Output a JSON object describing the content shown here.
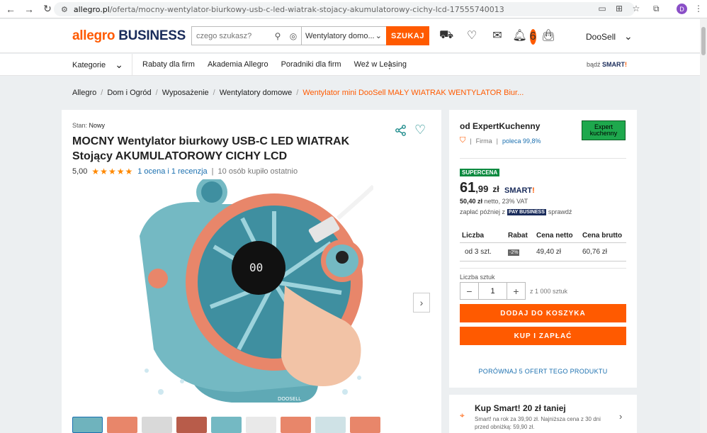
{
  "browser": {
    "url_domain": "allegro.pl",
    "url_path": "/oferta/mocny-wentylator-biurkowy-usb-c-led-wiatrak-stojacy-akumulatorowy-cichy-lcd-17555740013",
    "profile_initial": "D"
  },
  "header": {
    "logo_a": "allegro",
    "logo_b": "BUSINESS",
    "search_placeholder": "czego szukasz?",
    "search_category": "Wentylatory domo...",
    "search_button": "SZUKAJ",
    "notification_count": "6",
    "user": "DooSell"
  },
  "subnav": {
    "categories": "Kategorie",
    "links": [
      "Rabaty dla firm",
      "Akademia Allegro",
      "Poradniki dla firm",
      "Weź w Leasing"
    ],
    "smart_prefix": "bądź",
    "smart_label": "SMART"
  },
  "breadcrumbs": [
    "Allegro",
    "Dom i Ogród",
    "Wyposażenie",
    "Wentylatory domowe",
    "Wentylator mini DooSell MAŁY WIATRAK WENTYLATOR Biur..."
  ],
  "product": {
    "stan_label": "Stan:",
    "stan_value": "Nowy",
    "title": "MOCNY Wentylator biurkowy USB-C LED WIATRAK Stojący AKUMULATOROWY CICHY LCD",
    "rating": "5,00",
    "stars": "★★★★★",
    "reviews": "1 ocena i 1 recenzja",
    "sold": "10 osób kupiło ostatnio",
    "image_brand": "DOOSELL"
  },
  "offer": {
    "seller_prefix": "od",
    "seller": "ExpertKuchenny",
    "seller_type": "Firma",
    "recommend": "poleca 99,8%",
    "seller_logo": "Expert kuchenny",
    "badge": "SUPERCENA",
    "price_int": "61",
    "price_dec": ",99",
    "currency": "zł",
    "smart_label": "SMART",
    "netto_value": "50,40 zł",
    "netto_text": "netto, 23% VAT",
    "pay_prefix": "zapłać później z",
    "pay_brand": "PAY BUSINESS",
    "pay_suffix": "sprawdź",
    "table": {
      "headers": [
        "Liczba",
        "Rabat",
        "Cena netto",
        "Cena brutto"
      ],
      "rows": [
        [
          "od 3 szt.",
          "-2%",
          "49,40 zł",
          "60,76 zł"
        ]
      ]
    },
    "qty_label": "Liczba sztuk",
    "qty_value": "1",
    "qty_of": "z 1 000 sztuk",
    "add_to_cart": "DODAJ DO KOSZYKA",
    "buy_pay": "KUP I ZAPŁAĆ",
    "compare": "PORÓWNAJ 5 OFERT TEGO PRODUKTU"
  },
  "smart_promo": {
    "title": "Kup Smart! 20 zł taniej",
    "text": "Smart! na rok za 39,90 zł. Najniższa cena z 30 dni przed obniżką: 59,90 zł."
  },
  "colors": {
    "accent": "#ff5a00",
    "brand_navy": "#1a2c5b",
    "link": "#1a6faf",
    "fan_teal": "#5fa9b5",
    "fan_coral": "#e8866a"
  }
}
